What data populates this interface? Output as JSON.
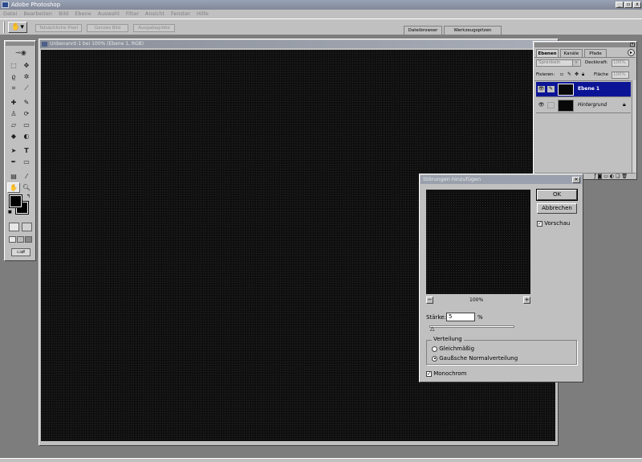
{
  "app": {
    "title": "Adobe Photoshop"
  },
  "menu": [
    "Datei",
    "Bearbeiten",
    "Bild",
    "Ebene",
    "Auswahl",
    "Filter",
    "Ansicht",
    "Fenster",
    "Hilfe"
  ],
  "options": {
    "btn1": "Tatsächliche Pixel",
    "btn2": "Ganzes Bild",
    "btn3": "Ausgabegröße",
    "tab1": "Dateibrowser",
    "tab2": "Werkzeugspitzen"
  },
  "document": {
    "title": "Unbenannt-1 bei 100% (Ebene 1, RGB)"
  },
  "layers_panel": {
    "tabs": [
      "Ebenen",
      "Kanäle",
      "Pfade"
    ],
    "blend_mode": "Sprenkeln",
    "opacity_label": "Deckkraft:",
    "opacity_value": "100%",
    "lock_label": "Fixieren:",
    "fill_label": "Fläche",
    "fill_value": "100%",
    "layers": [
      {
        "name": "Ebene 1",
        "selected": true
      },
      {
        "name": "Hintergrund",
        "selected": false
      }
    ]
  },
  "dialog": {
    "title": "Störungen hinzufügen",
    "ok": "OK",
    "cancel": "Abbrechen",
    "preview_label": "Vorschau",
    "preview_checked": true,
    "zoom": "100%",
    "amount_label": "Stärke:",
    "amount_value": "5",
    "amount_unit": "%",
    "distribution_label": "Verteilung",
    "dist_options": [
      "Gleichmäßig",
      "Gaußsche Normalverteilung"
    ],
    "dist_selected": 1,
    "mono_label": "Monochrom",
    "mono_checked": true
  },
  "colors": {
    "selection": "#0c1496",
    "canvas": "#0f0f10"
  }
}
